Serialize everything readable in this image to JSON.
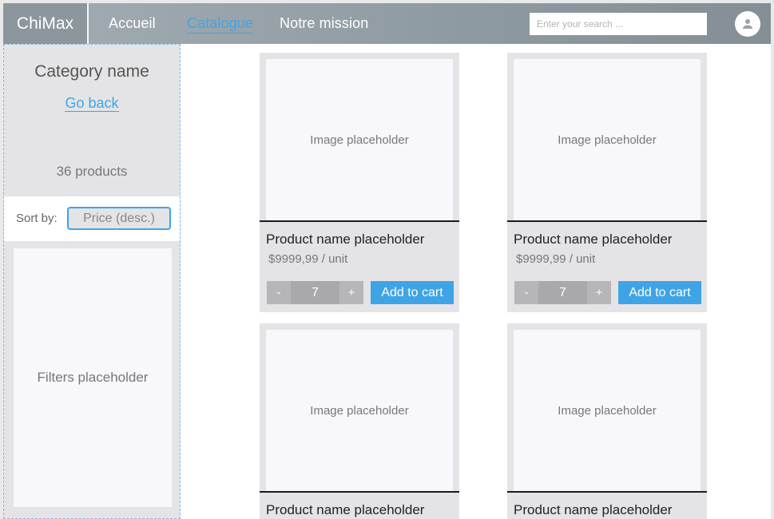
{
  "app": {
    "logo": "ChiMax"
  },
  "nav": {
    "items": [
      "Accueil",
      "Catalogue",
      "Notre mission"
    ],
    "active_index": 1
  },
  "search": {
    "placeholder": "Enter your search ..."
  },
  "header": {
    "avatar_icon": "user-icon"
  },
  "sidebar": {
    "category_name": "Category name",
    "go_back": "Go back",
    "product_count": "36 products",
    "sort_label": "Sort by:",
    "sort_value": "Price (desc.)",
    "filters_placeholder": "Filters placeholder"
  },
  "products": [
    {
      "image_placeholder": "Image placeholder",
      "name": "Product name placeholder",
      "price": "$9999,99 / unit",
      "qty": "7",
      "minus": "-",
      "plus": "+",
      "add_label": "Add to cart"
    },
    {
      "image_placeholder": "Image placeholder",
      "name": "Product name placeholder",
      "price": "$9999,99 / unit",
      "qty": "7",
      "minus": "-",
      "plus": "+",
      "add_label": "Add to cart"
    },
    {
      "image_placeholder": "Image placeholder",
      "name": "Product name placeholder"
    },
    {
      "image_placeholder": "Image placeholder",
      "name": "Product name placeholder"
    }
  ],
  "colors": {
    "accent": "#3fa4e6",
    "header": "#8e9aa1",
    "panel": "#e4e4e6"
  }
}
